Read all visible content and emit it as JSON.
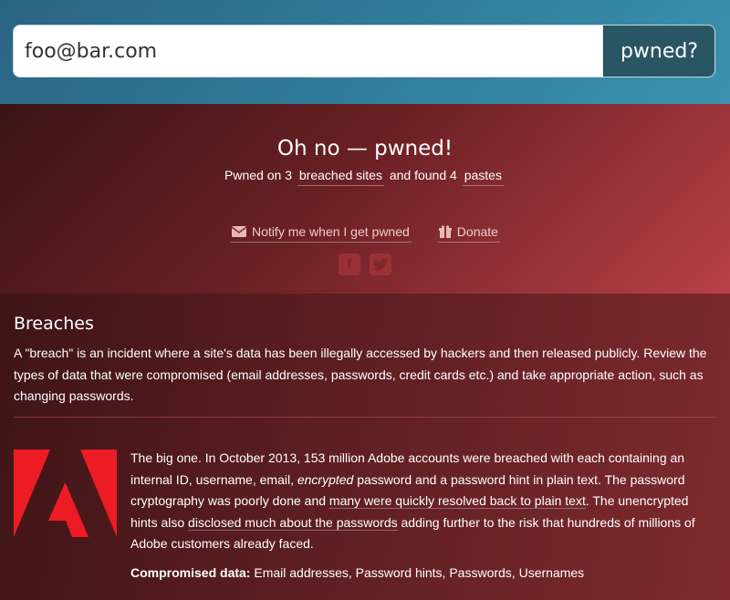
{
  "search": {
    "value": "foo@bar.com",
    "button_label": "pwned?"
  },
  "result": {
    "title": "Oh no — pwned!",
    "summary_prefix": "Pwned on 3",
    "breached_sites_link": "breached sites",
    "summary_middle": "and found 4",
    "pastes_link": "pastes",
    "notify_label": "Notify me when I get pwned",
    "donate_label": "Donate",
    "social": [
      {
        "icon": "facebook-icon",
        "glyph": "f"
      },
      {
        "icon": "twitter-icon",
        "glyph": "t"
      }
    ]
  },
  "breaches": {
    "title": "Breaches",
    "intro": "A \"breach\" is an incident where a site's data has been illegally accessed by hackers and then released publicly. Review the types of data that were compromised (email addresses, passwords, credit cards etc.) and take appropriate action, such as changing passwords.",
    "items": [
      {
        "name": "Adobe",
        "logo_color": "#ed1c24",
        "desc_1": "The big one. In October 2013, 153 million Adobe accounts were breached with each containing an internal ID, username, email, ",
        "desc_em": "encrypted",
        "desc_2": " password and a password hint in plain text. The password cryptography was poorly done and ",
        "link_1": "many were quickly resolved back to plain text",
        "desc_3": ". The unencrypted hints also ",
        "link_2": "disclosed much about the passwords",
        "desc_4": " adding further to the risk that hundreds of millions of Adobe customers already faced.",
        "compromised_label": "Compromised data:",
        "compromised_value": "Email addresses, Password hints, Passwords, Usernames"
      }
    ]
  }
}
